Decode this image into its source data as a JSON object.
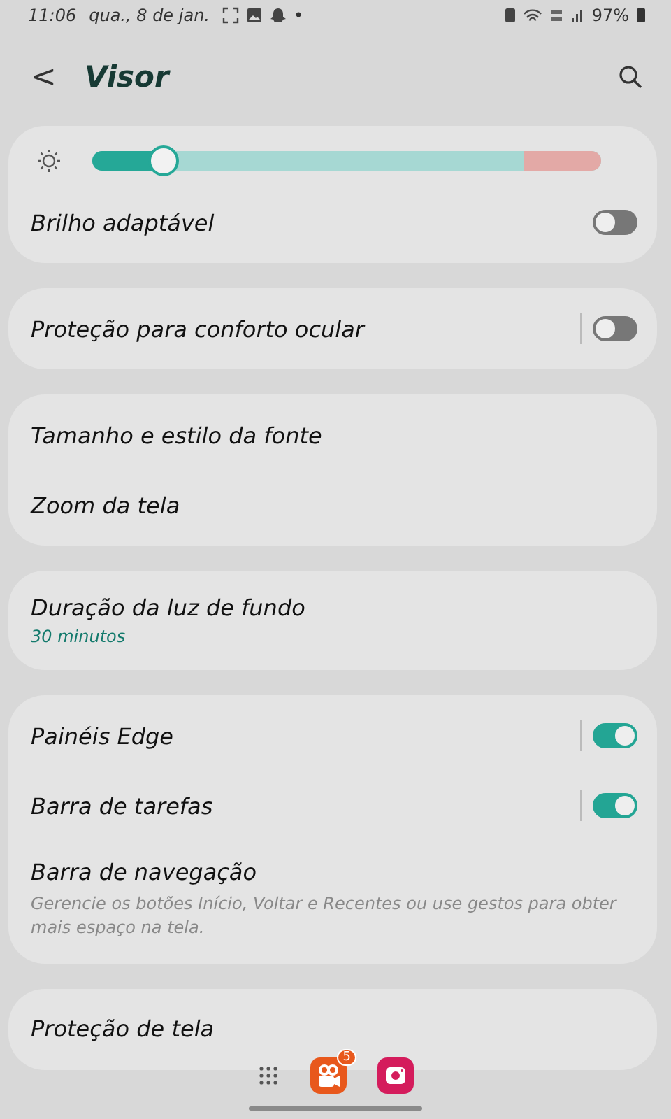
{
  "status_bar": {
    "time": "11:06",
    "date": "qua., 8 de jan.",
    "battery": "97%",
    "app_badge_dot": "•"
  },
  "header": {
    "back": "<",
    "title": "Visor"
  },
  "brightness": {
    "level": 0.14
  },
  "groups": [
    {
      "items": [
        {
          "kind": "switch",
          "label": "Brilho adaptável",
          "on": false
        }
      ]
    },
    {
      "items": [
        {
          "kind": "split-switch",
          "label": "Proteção para conforto ocular",
          "on": false
        }
      ]
    },
    {
      "items": [
        {
          "kind": "link",
          "label": "Tamanho e estilo da fonte"
        },
        {
          "kind": "link",
          "label": "Zoom da tela"
        }
      ]
    },
    {
      "items": [
        {
          "kind": "link",
          "label": "Duração da luz de fundo",
          "value": "30 minutos"
        }
      ]
    },
    {
      "items": [
        {
          "kind": "split-switch",
          "label": "Painéis Edge",
          "on": true
        },
        {
          "kind": "split-switch",
          "label": "Barra de tarefas",
          "on": true
        },
        {
          "kind": "link",
          "label": "Barra de navegação",
          "description": "Gerencie os botões Início, Voltar e Recentes ou use gestos para obter mais espaço na tela."
        }
      ]
    },
    {
      "items": [
        {
          "kind": "link",
          "label": "Proteção de tela"
        }
      ]
    }
  ],
  "taskbar": {
    "badge": "5"
  }
}
